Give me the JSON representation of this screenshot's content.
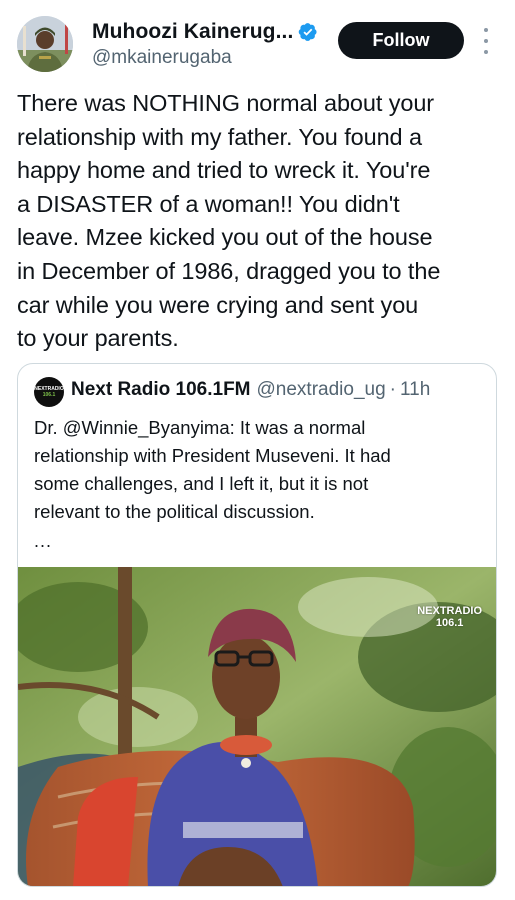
{
  "author": {
    "display_name": "Muhoozi Kainerug...",
    "handle": "@mkainerugaba",
    "verified": true,
    "avatar_icon": "profile-photo"
  },
  "actions": {
    "follow_label": "Follow",
    "more_icon": "more-vertical-icon"
  },
  "tweet": {
    "lines": [
      "There was NOTHING normal about your",
      "relationship with my father. You found a",
      "happy home and tried to wreck it. You're",
      "a DISASTER of a woman!! You didn't",
      "leave. Mzee kicked you out of the house",
      "in December of 1986, dragged you to the",
      "car while you were crying and sent you",
      "to your parents."
    ]
  },
  "quoted": {
    "avatar_text": "NEXTRADIO",
    "avatar_freq": "106.1",
    "name": "Next Radio 106.1FM",
    "handle": "@nextradio_ug",
    "separator": "·",
    "time": "11h",
    "lines": [
      "Dr. @Winnie_Byanyima: It was a normal",
      "relationship with President Museveni. It had",
      "some challenges, and I left it, but it is not",
      "relevant to the political discussion."
    ],
    "ellipsis": "...",
    "media_watermark_top": "NEXTRADIO",
    "media_watermark_bottom": "106.1"
  },
  "colors": {
    "text_primary": "#0f1419",
    "text_secondary": "#536471",
    "verified_blue": "#1d9bf0",
    "follow_bg": "#0f1419",
    "border": "#cfd9de"
  }
}
